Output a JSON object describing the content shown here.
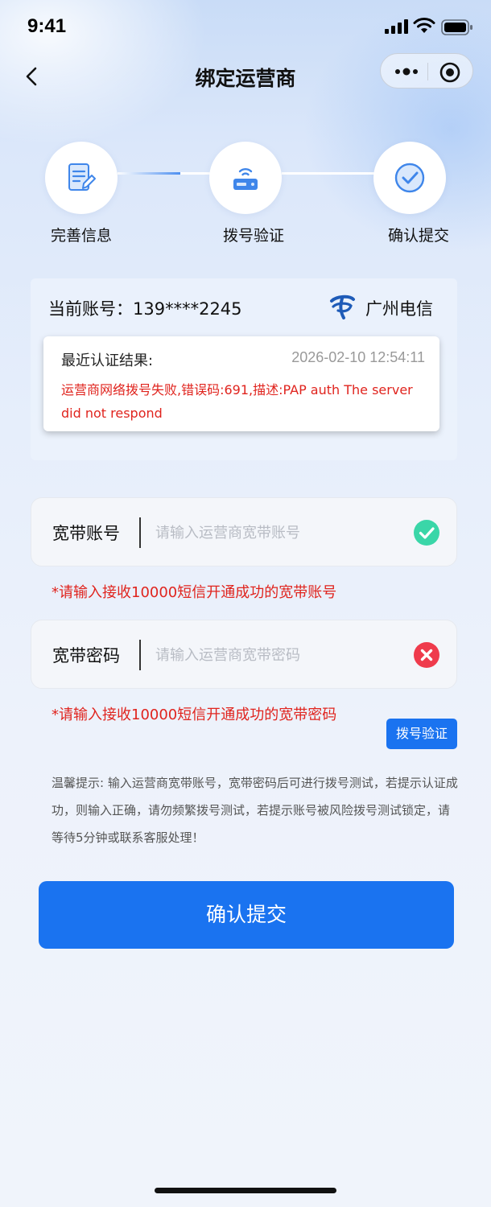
{
  "status_bar": {
    "time": "9:41"
  },
  "nav": {
    "title": "绑定运营商"
  },
  "steps": [
    {
      "label": "完善信息"
    },
    {
      "label": "拨号验证"
    },
    {
      "label": "确认提交"
    }
  ],
  "account": {
    "label": "当前账号：139****2245",
    "isp_name": "广州电信"
  },
  "result": {
    "title": "最近认证结果:",
    "time": "2026-02-10 12:54:11",
    "message": "运营商网络拨号失败,错误码:691,描述:PAP auth The server did not respond"
  },
  "broadband_account": {
    "label": "宽带账号",
    "placeholder": "请输入运营商宽带账号",
    "value": "",
    "status": "valid",
    "hint": "*请输入接收10000短信开通成功的宽带账号"
  },
  "broadband_password": {
    "label": "宽带密码",
    "placeholder": "请输入运营商宽带密码",
    "value": "",
    "status": "invalid",
    "hint": "*请输入接收10000短信开通成功的宽带密码"
  },
  "dial_button": {
    "label": "拨号验证"
  },
  "tips": "温馨提示: 输入运营商宽带账号，宽带密码后可进行拨号测试，若提示认证成功，则输入正确，请勿频繁拨号测试，若提示账号被风险拨号测试锁定，请等待5分钟或联系客服处理！",
  "submit_button": {
    "label": "确认提交"
  },
  "colors": {
    "primary": "#1a73f0",
    "error": "#e0241e",
    "success": "#3ad6a8",
    "danger": "#ef3b4c"
  }
}
